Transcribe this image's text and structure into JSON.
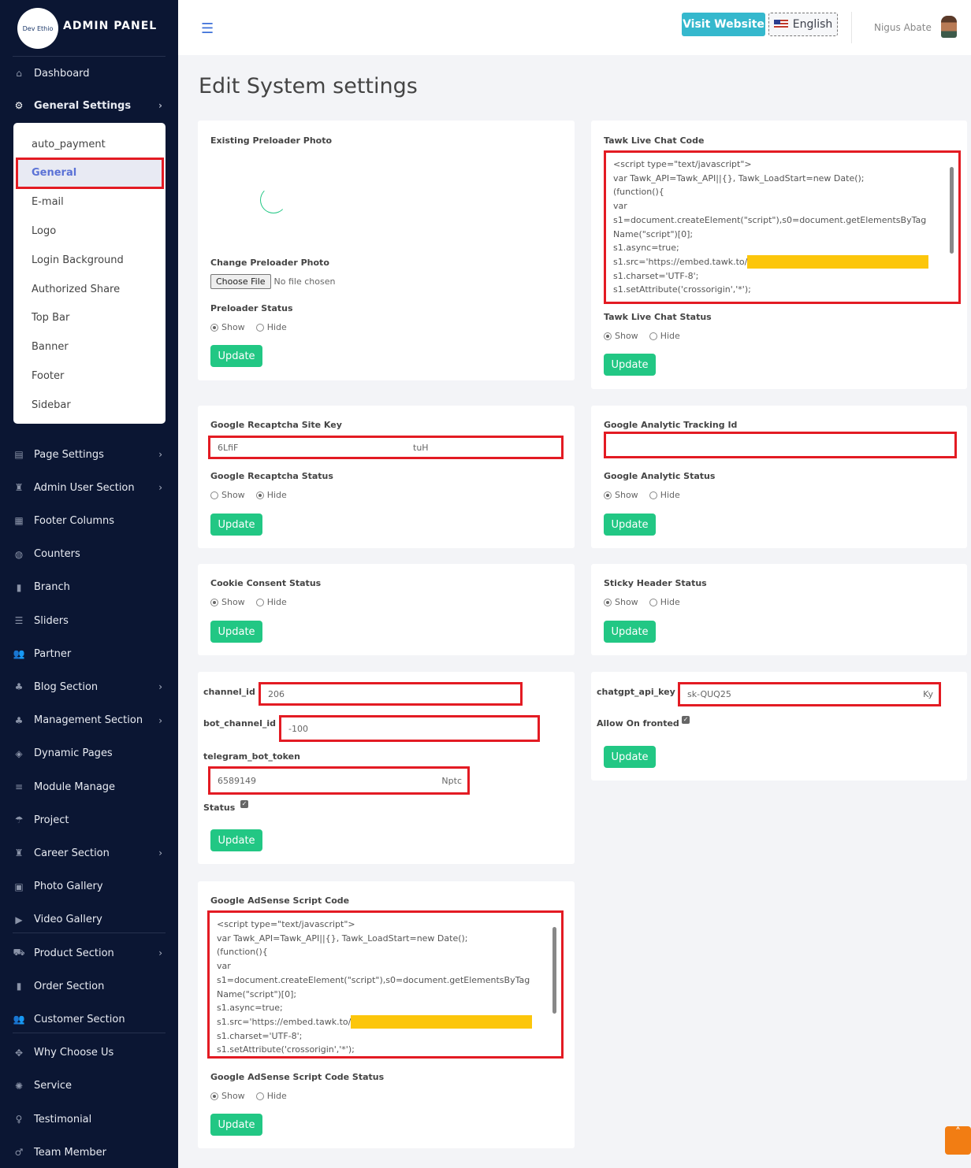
{
  "brand": {
    "title": "ADMIN PANEL",
    "logo_text": "Dev Ethio"
  },
  "sidebar": {
    "dashboard": "Dashboard",
    "general_settings": "General Settings",
    "sub": [
      "auto_payment",
      "General",
      "E-mail",
      "Logo",
      "Login Background",
      "Authorized Share",
      "Top Bar",
      "Banner",
      "Footer",
      "Sidebar"
    ],
    "items": [
      {
        "label": "Page Settings",
        "icon": "▤",
        "chev": true
      },
      {
        "label": "Admin User Section",
        "icon": "♜",
        "chev": true
      },
      {
        "label": "Footer Columns",
        "icon": "▦",
        "chev": false
      },
      {
        "label": "Counters",
        "icon": "◍",
        "chev": false
      },
      {
        "label": "Branch",
        "icon": "▮",
        "chev": false
      },
      {
        "label": "Sliders",
        "icon": "☰",
        "chev": false
      },
      {
        "label": "Partner",
        "icon": "👥",
        "chev": false
      },
      {
        "label": "Blog Section",
        "icon": "♣",
        "chev": true
      },
      {
        "label": "Management Section",
        "icon": "♣",
        "chev": true
      },
      {
        "label": "Dynamic Pages",
        "icon": "◈",
        "chev": false
      },
      {
        "label": "Module Manage",
        "icon": "≡",
        "chev": false
      },
      {
        "label": "Project",
        "icon": "☂",
        "chev": false
      },
      {
        "label": "Career Section",
        "icon": "♜",
        "chev": true
      },
      {
        "label": "Photo Gallery",
        "icon": "▣",
        "chev": false
      },
      {
        "label": "Video Gallery",
        "icon": "▶",
        "chev": false
      },
      {
        "label": "Product Section",
        "icon": "⛟",
        "chev": true
      },
      {
        "label": "Order Section",
        "icon": "▮",
        "chev": false
      },
      {
        "label": "Customer Section",
        "icon": "👥",
        "chev": false
      },
      {
        "label": "Why Choose Us",
        "icon": "✥",
        "chev": false
      },
      {
        "label": "Service",
        "icon": "✺",
        "chev": false
      },
      {
        "label": "Testimonial",
        "icon": "♀",
        "chev": false
      },
      {
        "label": "Team Member",
        "icon": "♂",
        "chev": false
      }
    ]
  },
  "header": {
    "visit": "Visit Website",
    "language": "English",
    "user": "Nigus Abate"
  },
  "page_title": "Edit System settings",
  "common": {
    "show": "Show",
    "hide": "Hide",
    "update": "Update"
  },
  "preloader": {
    "existing": "Existing Preloader Photo",
    "change": "Change Preloader Photo",
    "choose": "Choose File",
    "nofile": "No file chosen",
    "status": "Preloader Status",
    "selected": "show"
  },
  "tawk": {
    "label": "Tawk Live Chat Code",
    "lines": [
      "<script type=\"text/javascript\">",
      "var Tawk_API=Tawk_API||{}, Tawk_LoadStart=new Date();",
      "(function(){",
      "var",
      "s1=document.createElement(\"script\"),s0=document.getElementsByTag",
      "Name(\"script\")[0];",
      "s1.async=true;",
      "s1.src='https://embed.tawk.to/",
      "s1.charset='UTF-8';",
      "s1.setAttribute('crossorigin','*');"
    ],
    "status": "Tawk Live Chat Status",
    "selected": "show"
  },
  "recaptcha": {
    "label": "Google Recaptcha Site Key",
    "value_start": "6LfiF",
    "value_end": "tuH",
    "status": "Google Recaptcha Status",
    "selected": "hide"
  },
  "analytics": {
    "label": "Google Analytic Tracking Id",
    "value": "",
    "status": "Google Analytic Status",
    "selected": "show"
  },
  "cookie": {
    "status": "Cookie Consent Status",
    "selected": "show"
  },
  "sticky": {
    "status": "Sticky Header Status",
    "selected": "show"
  },
  "telegram": {
    "channel_label": "channel_id",
    "channel_value": "206",
    "bot_channel_label": "bot_channel_id",
    "bot_channel_value": "-100",
    "token_label": "telegram_bot_token",
    "token_start": "6589149",
    "token_end": "Nptc",
    "status": "Status",
    "checked": true
  },
  "chatgpt": {
    "label": "chatgpt_api_key",
    "value_start": "sk-QUQ25",
    "value_end": "Ky",
    "allow": "Allow On fronted",
    "checked": true
  },
  "adsense": {
    "label": "Google AdSense Script Code",
    "lines": [
      "<script type=\"text/javascript\">",
      "var Tawk_API=Tawk_API||{}, Tawk_LoadStart=new Date();",
      "(function(){",
      "var",
      "s1=document.createElement(\"script\"),s0=document.getElementsByTag",
      "Name(\"script\")[0];",
      "s1.async=true;",
      "s1.src='https://embed.tawk.to/",
      "s1.charset='UTF-8';",
      "s1.setAttribute('crossorigin','*');"
    ],
    "status": "Google AdSense Script Code Status",
    "selected": "show"
  },
  "colors": {
    "sidebar": "#0b1633",
    "accent": "#22c784",
    "visit": "#35b8cd",
    "highlight": "#e31b23",
    "redaction": "#fcc60b"
  }
}
